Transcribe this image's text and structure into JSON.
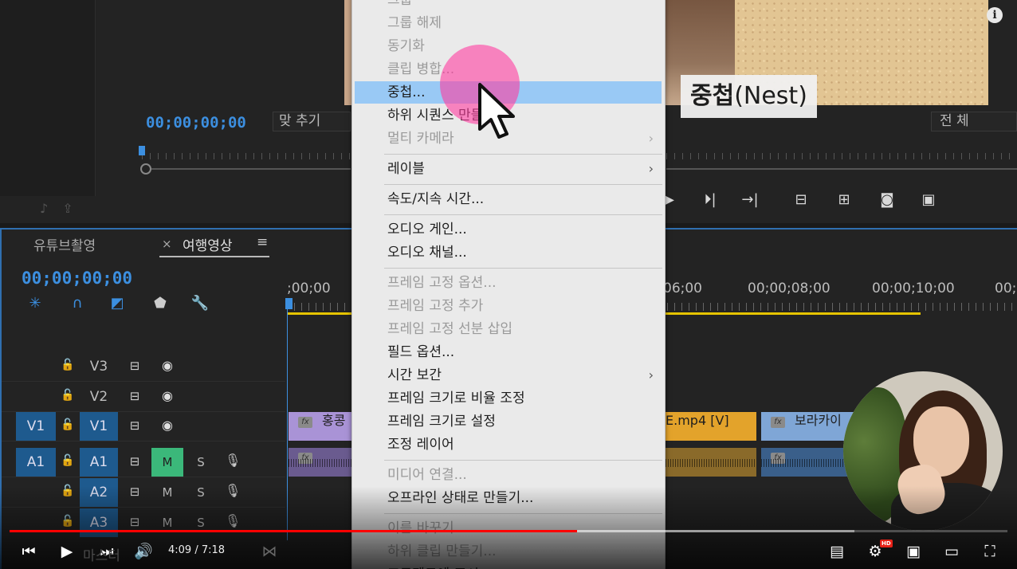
{
  "program_monitor": {
    "timecode": "00;00;00;00",
    "fit_label": "맞 추기",
    "full_label": "전 체",
    "caption_bold": "중첩",
    "caption_light": "(Nest)"
  },
  "timeline": {
    "tab_inactive": "유튜브촬영",
    "tab_close": "×",
    "tab_active": "여행영상",
    "tab_menu": "≡",
    "timecode": "00;00;00;00",
    "ruler_labels": [
      ";00;00",
      "06;00",
      "00;00;08;00",
      "00;00;10;00",
      "00;"
    ],
    "tracks": [
      {
        "name": "V3"
      },
      {
        "name": "V2"
      },
      {
        "src": "V1",
        "name": "V1"
      },
      {
        "src": "A1",
        "name": "A1",
        "mute": "M",
        "solo": "S"
      },
      {
        "name": "A2",
        "mute": "M",
        "solo": "S"
      },
      {
        "name": "A3",
        "mute": "M",
        "solo": "S"
      }
    ],
    "clips": {
      "v1_a": "홍콩",
      "v1_b": "E.mp4 [V]",
      "v1_c": "보라카이",
      "fx": "fx"
    }
  },
  "context_menu": {
    "items": [
      {
        "label": "그룹",
        "state": "disabled"
      },
      {
        "label": "그룹 해제",
        "state": "disabled"
      },
      {
        "label": "동기화",
        "state": "disabled"
      },
      {
        "label": "클립 병합...",
        "state": "disabled"
      },
      {
        "label": "중첩...",
        "state": "highlight"
      },
      {
        "label": "하위 시퀀스 만들기",
        "state": "enabled"
      },
      {
        "label": "멀티 카메라",
        "state": "disabled",
        "submenu": true
      },
      {
        "label": "레이블",
        "state": "enabled",
        "submenu": true
      },
      {
        "label": "속도/지속 시간...",
        "state": "enabled"
      },
      {
        "label": "오디오 게인...",
        "state": "enabled"
      },
      {
        "label": "오디오 채널...",
        "state": "enabled"
      },
      {
        "label": "프레임 고정 옵션...",
        "state": "disabled"
      },
      {
        "label": "프레임 고정 추가",
        "state": "disabled"
      },
      {
        "label": "프레임 고정 선분 삽입",
        "state": "disabled"
      },
      {
        "label": "필드 옵션...",
        "state": "enabled"
      },
      {
        "label": "시간 보간",
        "state": "enabled",
        "submenu": true
      },
      {
        "label": "프레임 크기로 비율 조정",
        "state": "enabled"
      },
      {
        "label": "프레임 크기로 설정",
        "state": "enabled"
      },
      {
        "label": "조정 레이어",
        "state": "enabled"
      },
      {
        "label": "미디어 연결...",
        "state": "disabled"
      },
      {
        "label": "오프라인 상태로 만들기...",
        "state": "enabled"
      },
      {
        "label": "이름 바꾸기...",
        "state": "disabled"
      },
      {
        "label": "하위 클립 만들기...",
        "state": "disabled"
      },
      {
        "label": "프로젝트에 표시",
        "state": "enabled"
      }
    ],
    "arrow_glyph": "›"
  },
  "player": {
    "time": "4:09 / 7:18",
    "hd": "HD",
    "ghost_text": "마스터",
    "progress_played": 0.5687,
    "progress_loaded": 0.8466
  },
  "icons": {
    "info": "i"
  },
  "colors": {
    "accent_blue": "#3c8fe0",
    "track_on": "#1e5a8e",
    "mute_on": "#3bb87a",
    "menu_highlight": "#99c9f5",
    "progress_red": "#ff0000",
    "clip_purple": "#a993d6",
    "clip_orange": "#e3a32b",
    "clip_blue": "#7fa6d6",
    "audio_purple": "#6a5b8f",
    "audio_orange": "#8a6a2a",
    "audio_blue": "#3a5f8a"
  }
}
